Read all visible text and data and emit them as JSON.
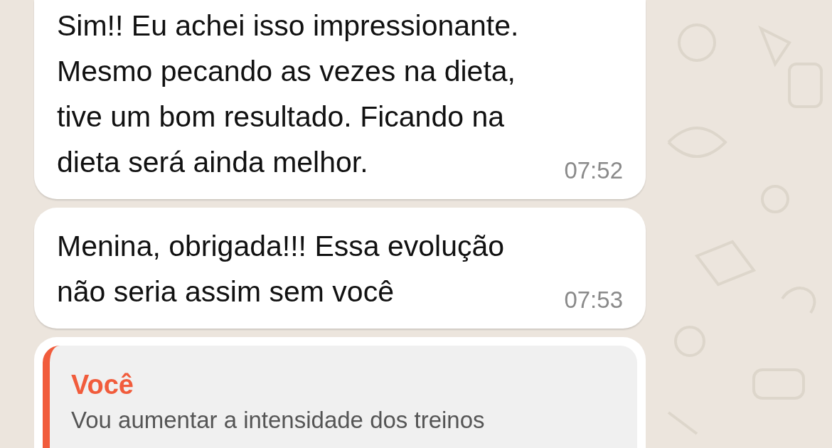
{
  "messages": [
    {
      "kind": "text",
      "text": "Sim!! Eu achei isso impressionante.\nMesmo pecando as vezes na dieta,\ntive um bom resultado. Ficando na\ndieta será ainda melhor.",
      "time": "07:52"
    },
    {
      "kind": "text",
      "text": "Menina, obrigada!!! Essa evolução\nnão seria assim sem você",
      "time": "07:53"
    },
    {
      "kind": "reply",
      "quote": {
        "author": "Você",
        "text": "Vou aumentar a intensidade dos treinos",
        "color": "#f15c3c"
      }
    }
  ]
}
